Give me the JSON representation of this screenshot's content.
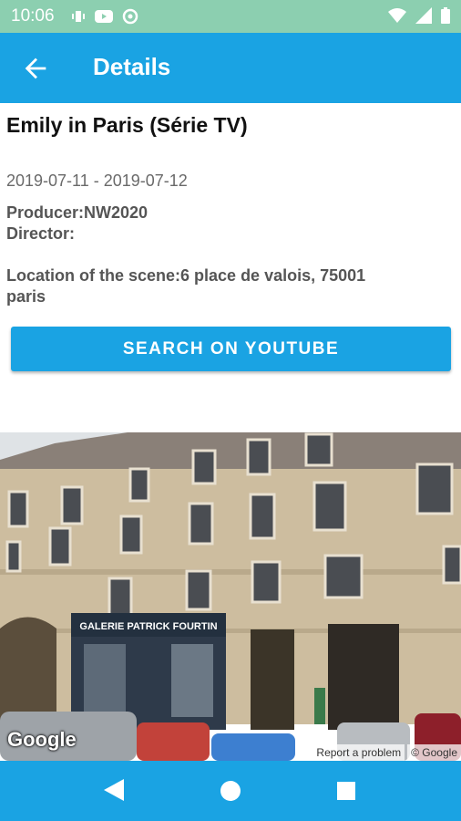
{
  "status_bar": {
    "time": "10:06"
  },
  "app_bar": {
    "title": "Details"
  },
  "details": {
    "title": "Emily in Paris (Série TV)",
    "dates": "2019-07-11 - 2019-07-12",
    "producer": "Producer:NW2020",
    "director": "Director:",
    "location": "Location of the scene:6 place de valois, 75001 paris",
    "youtube_button": "SEARCH ON YOUTUBE"
  },
  "street_view": {
    "google_logo": "Google",
    "report_link": "Report a problem",
    "copyright": "© Google",
    "storefront_sign": "GALERIE PATRICK FOURTIN"
  },
  "colors": {
    "primary": "#1aa3e3",
    "status_bar": "#8ccfb0"
  }
}
